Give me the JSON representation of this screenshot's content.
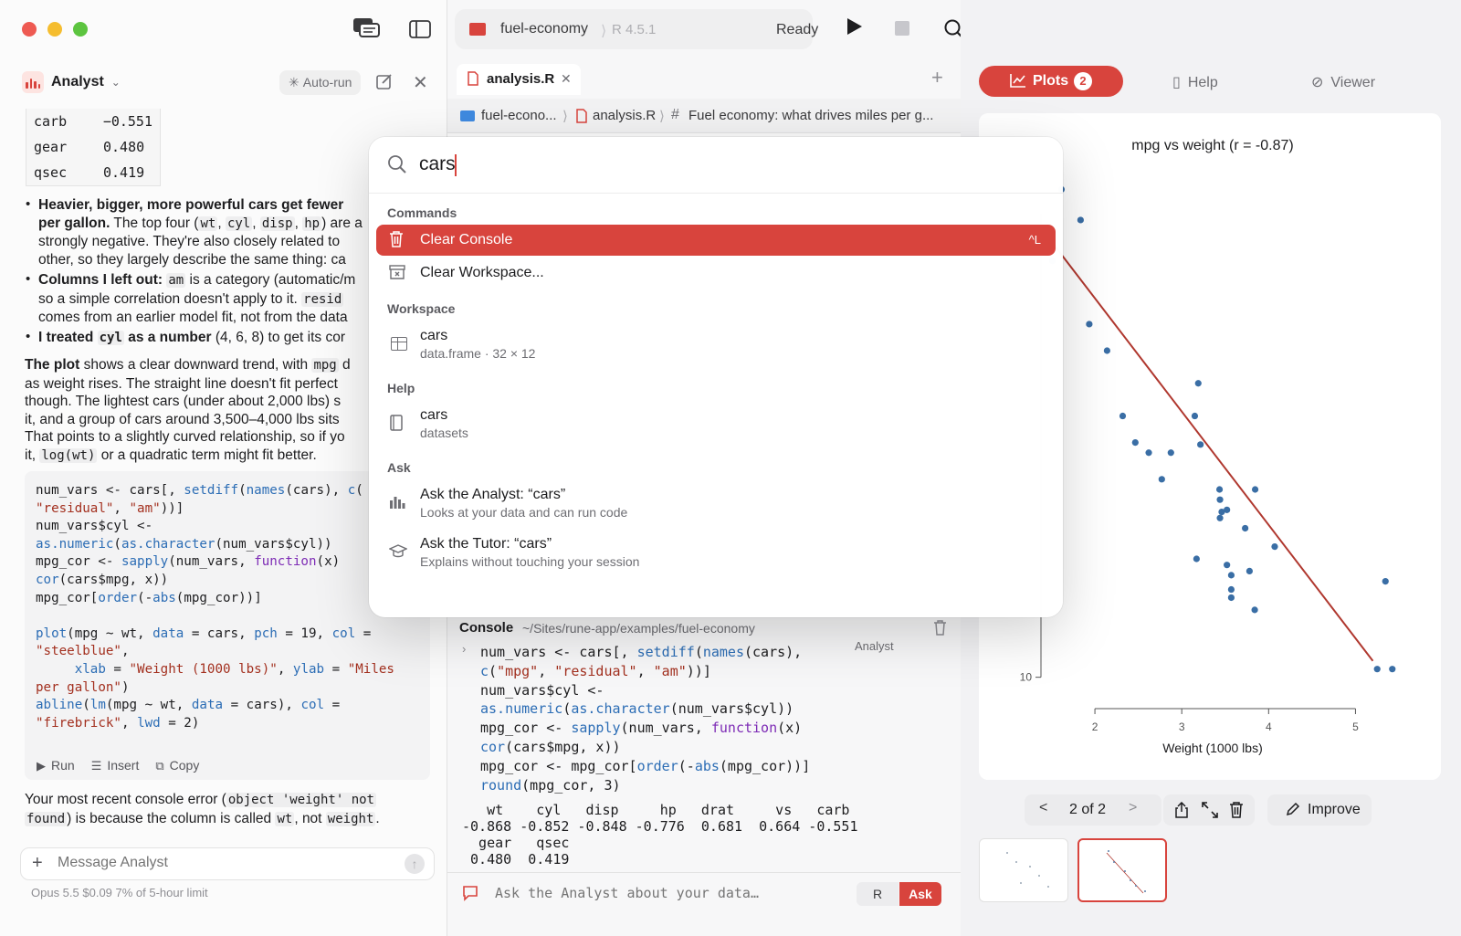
{
  "left": {
    "assistant_name": "Analyst",
    "autorun_label": "Auto-run",
    "corr_rows": [
      {
        "name": "carb",
        "value": "−0.551"
      },
      {
        "name": "gear",
        "value": "0.480"
      },
      {
        "name": "qsec",
        "value": "0.419"
      }
    ],
    "bullets": {
      "b1": {
        "bold": "Heavier, bigger, more powerful cars get fewer",
        "bold2": "per gallon.",
        "t1": " The top four (",
        "c1": "wt",
        "t2": ", ",
        "c2": "cyl",
        "t3": ", ",
        "c3": "disp",
        "t4": ", ",
        "c4": "hp",
        "t5": ") are a",
        "l3": "strongly negative. They're also closely related to",
        "l4": "other, so they largely describe the same thing: ca"
      },
      "b2": {
        "bold": "Columns I left out:",
        "c1": "am",
        "t1": " is a category (automatic/m",
        "l2a": "so a simple correlation doesn't apply to it. ",
        "c2": "resid",
        "l3": "comes from an earlier model fit, not from the data"
      },
      "b3": {
        "bold1": "I treated ",
        "c1": "cyl",
        "bold2": " as a number",
        "t1": " (4, 6, 8) to get its cor"
      }
    },
    "plot_para": {
      "bold": "The plot",
      "t1": " shows a clear downward trend, with ",
      "c1": "mpg",
      "t2": " d",
      "l2": "as weight rises. The straight line doesn't fit perfect",
      "l3": "though. The lightest cars (under about 2,000 lbs) s",
      "l4": "it, and a group of cars around 3,500–4,000 lbs sits",
      "l5": "That points to a slightly curved relationship, so if yo",
      "l6a": "it, ",
      "c6a": "log(wt)",
      "l6b": " or a quadratic term might fit better."
    },
    "code_actions": {
      "run": "Run",
      "insert": "Insert",
      "copy": "Copy"
    },
    "error_para": {
      "t1": "Your most recent console error (",
      "c1": "object 'weight' not",
      "c2": "found",
      "t2": ") is because the column is called ",
      "c3": "wt",
      "t3": ", not ",
      "c4": "weight",
      "t4": "."
    },
    "message_placeholder": "Message Analyst",
    "usage": "Opus 5.5  $0.09  7% of 5-hour limit"
  },
  "middle": {
    "project_name": "fuel-economy",
    "r_version": "R 4.5.1",
    "status": "Ready",
    "tab_name": "analysis.R",
    "breadcrumb": {
      "folder": "fuel-econo...",
      "file": "analysis.R",
      "section": "Fuel economy: what drives miles per g..."
    },
    "console_title": "Console",
    "console_path": "~/Sites/rune-app/examples/fuel-economy",
    "analyst_tag": "Analyst",
    "console_output": {
      "out1": "   wt    cyl   disp     hp   drat     vs   carb",
      "out2": "-0.868 -0.852 -0.848 -0.776  0.681  0.664 -0.551",
      "out3": "  gear   qsec",
      "out4": " 0.480  0.419"
    },
    "ask_placeholder": "Ask the Analyst about your data…",
    "btn_r": "R",
    "btn_ask": "Ask"
  },
  "right": {
    "tabs": {
      "plots": "Plots",
      "plots_count": "2",
      "help": "Help",
      "viewer": "Viewer"
    },
    "plot_counter": "2 of 2",
    "improve_label": "Improve"
  },
  "palette": {
    "query": "cars",
    "sections": {
      "commands": "Commands",
      "workspace": "Workspace",
      "help": "Help",
      "ask": "Ask"
    },
    "items": {
      "clear_console": {
        "title": "Clear Console",
        "shortcut": "^L"
      },
      "clear_workspace": {
        "title": "Clear Workspace..."
      },
      "workspace_cars": {
        "title": "cars",
        "subtitle": "data.frame · 32 × 12"
      },
      "help_cars": {
        "title": "cars",
        "subtitle": "datasets"
      },
      "ask_analyst": {
        "title": "Ask the Analyst: “cars”",
        "subtitle": "Looks at your data and can run code"
      },
      "ask_tutor": {
        "title": "Ask the Tutor: “cars”",
        "subtitle": "Explains without touching your session"
      }
    }
  },
  "colors": {
    "accent": "#d8443d",
    "point": "#3a6ea5",
    "line": "#b0382f"
  },
  "chart_data": {
    "type": "scatter",
    "title": "mpg vs weight (r = -0.87)",
    "xlabel": "Weight (1000 lbs)",
    "ylabel": "",
    "xlim": [
      1.4,
      5.5
    ],
    "ylim": [
      9,
      34.5
    ],
    "xticks": [
      2,
      3,
      4,
      5
    ],
    "yticks": [
      10
    ],
    "trend_line": {
      "x": [
        1.4,
        5.2
      ],
      "y": [
        31.9,
        10.8
      ]
    },
    "points": [
      {
        "x": 1.51,
        "y": 30.4
      },
      {
        "x": 1.615,
        "y": 33.9
      },
      {
        "x": 1.835,
        "y": 32.4
      },
      {
        "x": 1.935,
        "y": 27.3
      },
      {
        "x": 2.14,
        "y": 26.0
      },
      {
        "x": 2.32,
        "y": 22.8
      },
      {
        "x": 2.465,
        "y": 21.5
      },
      {
        "x": 2.62,
        "y": 21.0
      },
      {
        "x": 2.77,
        "y": 19.7
      },
      {
        "x": 2.875,
        "y": 21.0
      },
      {
        "x": 3.15,
        "y": 22.8
      },
      {
        "x": 3.17,
        "y": 15.8
      },
      {
        "x": 3.19,
        "y": 24.4
      },
      {
        "x": 3.215,
        "y": 21.4
      },
      {
        "x": 3.435,
        "y": 19.2
      },
      {
        "x": 3.44,
        "y": 18.7
      },
      {
        "x": 3.44,
        "y": 17.8
      },
      {
        "x": 3.46,
        "y": 18.1
      },
      {
        "x": 3.52,
        "y": 15.5
      },
      {
        "x": 3.57,
        "y": 15.0
      },
      {
        "x": 3.57,
        "y": 14.3
      },
      {
        "x": 3.73,
        "y": 17.3
      },
      {
        "x": 3.78,
        "y": 15.2
      },
      {
        "x": 3.84,
        "y": 13.3
      },
      {
        "x": 3.845,
        "y": 19.2
      },
      {
        "x": 4.07,
        "y": 16.4
      },
      {
        "x": 5.25,
        "y": 10.4
      },
      {
        "x": 5.345,
        "y": 14.7
      },
      {
        "x": 5.424,
        "y": 10.4
      },
      {
        "x": 3.52,
        "y": 18.2
      },
      {
        "x": 3.57,
        "y": 13.9
      }
    ]
  }
}
